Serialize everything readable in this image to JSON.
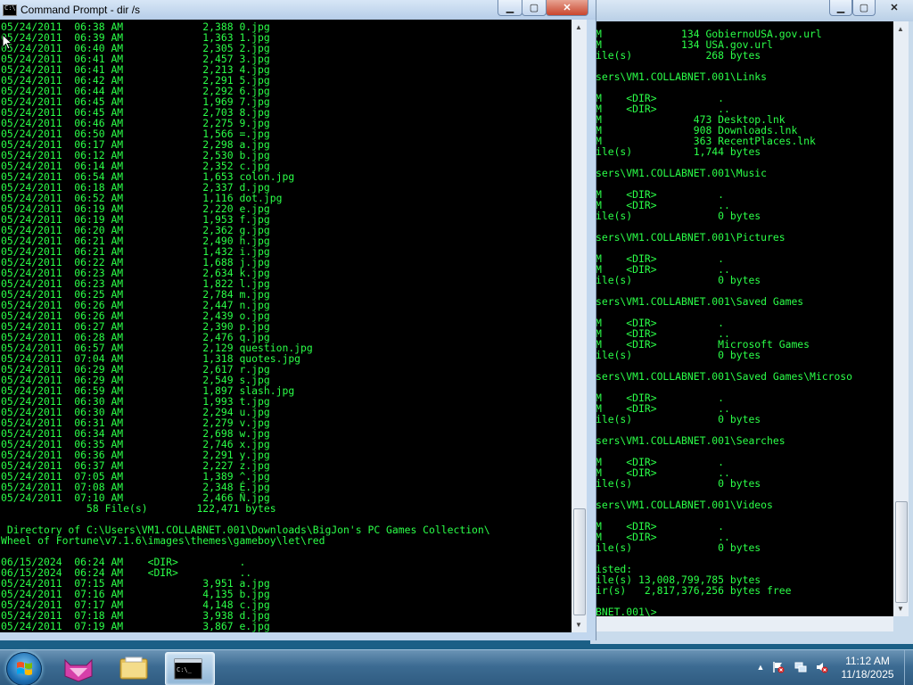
{
  "front_window": {
    "title": "Command Prompt - dir /s",
    "controls": {
      "minimize": "▁",
      "maximize": "▢",
      "close": "✕"
    },
    "lines": [
      "05/24/2011  06:38 AM             2,388 0.jpg",
      "05/24/2011  06:39 AM             1,363 1.jpg",
      "05/24/2011  06:40 AM             2,305 2.jpg",
      "05/24/2011  06:41 AM             2,457 3.jpg",
      "05/24/2011  06:41 AM             2,213 4.jpg",
      "05/24/2011  06:42 AM             2,291 5.jpg",
      "05/24/2011  06:44 AM             2,292 6.jpg",
      "05/24/2011  06:45 AM             1,969 7.jpg",
      "05/24/2011  06:45 AM             2,703 8.jpg",
      "05/24/2011  06:46 AM             2,275 9.jpg",
      "05/24/2011  06:50 AM             1,566 =.jpg",
      "05/24/2011  06:17 AM             2,298 a.jpg",
      "05/24/2011  06:12 AM             2,530 b.jpg",
      "05/24/2011  06:14 AM             2,352 c.jpg",
      "05/24/2011  06:54 AM             1,653 colon.jpg",
      "05/24/2011  06:18 AM             2,337 d.jpg",
      "05/24/2011  06:52 AM             1,116 dot.jpg",
      "05/24/2011  06:19 AM             2,220 e.jpg",
      "05/24/2011  06:19 AM             1,953 f.jpg",
      "05/24/2011  06:20 AM             2,362 g.jpg",
      "05/24/2011  06:21 AM             2,490 h.jpg",
      "05/24/2011  06:21 AM             1,432 i.jpg",
      "05/24/2011  06:22 AM             1,688 j.jpg",
      "05/24/2011  06:23 AM             2,634 k.jpg",
      "05/24/2011  06:23 AM             1,822 l.jpg",
      "05/24/2011  06:25 AM             2,784 m.jpg",
      "05/24/2011  06:26 AM             2,447 n.jpg",
      "05/24/2011  06:26 AM             2,439 o.jpg",
      "05/24/2011  06:27 AM             2,390 p.jpg",
      "05/24/2011  06:28 AM             2,476 q.jpg",
      "05/24/2011  06:57 AM             2,129 question.jpg",
      "05/24/2011  07:04 AM             1,318 quotes.jpg",
      "05/24/2011  06:29 AM             2,617 r.jpg",
      "05/24/2011  06:29 AM             2,549 s.jpg",
      "05/24/2011  06:59 AM             1,897 slash.jpg",
      "05/24/2011  06:30 AM             1,993 t.jpg",
      "05/24/2011  06:30 AM             2,294 u.jpg",
      "05/24/2011  06:31 AM             2,279 v.jpg",
      "05/24/2011  06:34 AM             2,698 w.jpg",
      "05/24/2011  06:35 AM             2,746 x.jpg",
      "05/24/2011  06:36 AM             2,291 y.jpg",
      "05/24/2011  06:37 AM             2,227 z.jpg",
      "05/24/2011  07:05 AM             1,389 ^.jpg",
      "05/24/2011  07:08 AM             2,348 É.jpg",
      "05/24/2011  07:10 AM             2,466 Ñ.jpg",
      "              58 File(s)        122,471 bytes",
      "",
      " Directory of C:\\Users\\VM1.COLLABNET.001\\Downloads\\BigJon's PC Games Collection\\",
      "Wheel of Fortune\\v7.1.6\\images\\themes\\gameboy\\let\\red",
      "",
      "06/15/2024  06:24 AM    <DIR>          .",
      "06/15/2024  06:24 AM    <DIR>          ..",
      "05/24/2011  07:15 AM             3,951 a.jpg",
      "05/24/2011  07:16 AM             4,135 b.jpg",
      "05/24/2011  07:17 AM             4,148 c.jpg",
      "05/24/2011  07:18 AM             3,938 d.jpg",
      "05/24/2011  07:19 AM             3,867 e.jpg"
    ]
  },
  "back_window": {
    "controls": {
      "minimize": "▁",
      "maximize": "▢",
      "close": "✕"
    },
    "lines": [
      "M             134 GobiernoUSA.gov.url",
      "M             134 USA.gov.url",
      "ile(s)            268 bytes",
      "",
      "sers\\VM1.COLLABNET.001\\Links",
      "",
      "M    <DIR>          .",
      "M    <DIR>          ..",
      "M               473 Desktop.lnk",
      "M               908 Downloads.lnk",
      "M               363 RecentPlaces.lnk",
      "ile(s)          1,744 bytes",
      "",
      "sers\\VM1.COLLABNET.001\\Music",
      "",
      "M    <DIR>          .",
      "M    <DIR>          ..",
      "ile(s)              0 bytes",
      "",
      "sers\\VM1.COLLABNET.001\\Pictures",
      "",
      "M    <DIR>          .",
      "M    <DIR>          ..",
      "ile(s)              0 bytes",
      "",
      "sers\\VM1.COLLABNET.001\\Saved Games",
      "",
      "M    <DIR>          .",
      "M    <DIR>          ..",
      "M    <DIR>          Microsoft Games",
      "ile(s)              0 bytes",
      "",
      "sers\\VM1.COLLABNET.001\\Saved Games\\Microso",
      "",
      "M    <DIR>          .",
      "M    <DIR>          ..",
      "ile(s)              0 bytes",
      "",
      "sers\\VM1.COLLABNET.001\\Searches",
      "",
      "M    <DIR>          .",
      "M    <DIR>          ..",
      "ile(s)              0 bytes",
      "",
      "sers\\VM1.COLLABNET.001\\Videos",
      "",
      "M    <DIR>          .",
      "M    <DIR>          ..",
      "ile(s)              0 bytes",
      "",
      "isted:",
      "ile(s) 13,008,799,785 bytes",
      "ir(s)   2,817,376,256 bytes free",
      "",
      "BNET.001\\>"
    ]
  },
  "taskbar": {
    "start_icon": "windows-orb",
    "pinned": [
      {
        "name": "pink-cat-app",
        "icon": "cat-icon"
      },
      {
        "name": "windows-explorer",
        "icon": "folder-icon"
      },
      {
        "name": "command-prompt",
        "icon": "cmd-icon",
        "active": true
      }
    ],
    "tray_icons": [
      "show-hidden-icons-arrow",
      "action-center-flag",
      "network-icon",
      "volume-muted-icon"
    ],
    "show_hidden_glyph": "▲",
    "clock": {
      "time": "11:12 AM",
      "date": "11/18/2025"
    }
  },
  "colors": {
    "console_text": "#2bff48",
    "console_bg": "#000000",
    "taskbar": "#3c6b92"
  }
}
